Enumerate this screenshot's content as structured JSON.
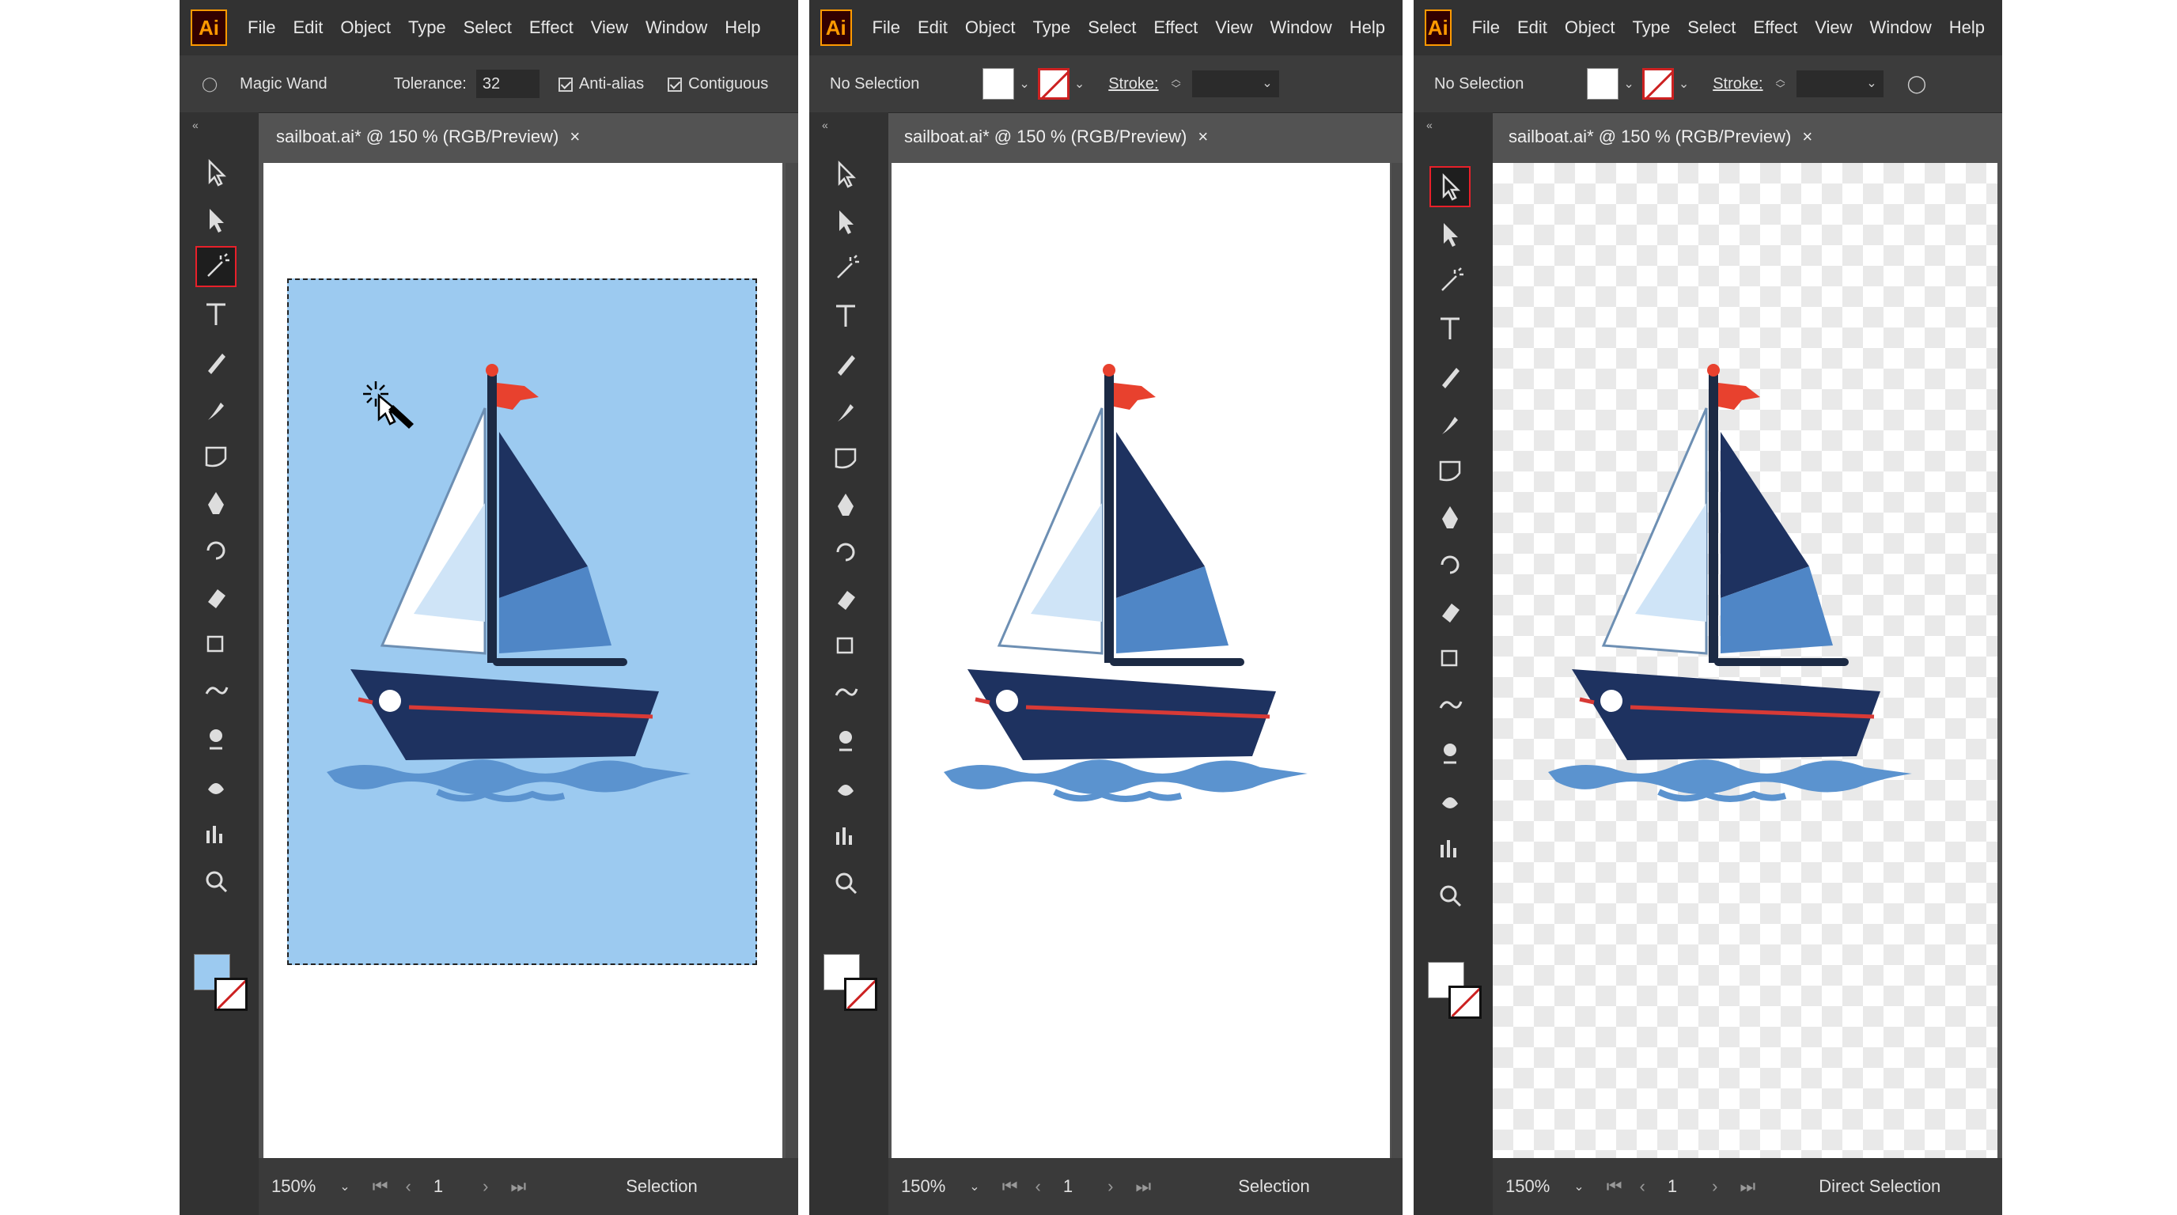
{
  "menu": [
    "File",
    "Edit",
    "Object",
    "Type",
    "Select",
    "Effect",
    "View",
    "Window",
    "Help"
  ],
  "app_logo": "Ai",
  "panels": [
    {
      "control": {
        "tool_name": "Magic Wand",
        "tolerance_label": "Tolerance:",
        "tolerance_value": "32",
        "antialias_label": "Anti-alias",
        "contiguous_label": "Contiguous"
      },
      "tab_title": "sailboat.ai* @ 150 % (RGB/Preview)",
      "status": {
        "zoom": "150%",
        "page": "1",
        "tool": "Selection"
      },
      "active_tool": "magic-wand",
      "fill_color": "#9ccaf0",
      "background": "#9ccaf0"
    },
    {
      "control": {
        "selection": "No Selection",
        "stroke_label": "Stroke:"
      },
      "tab_title": "sailboat.ai* @ 150 % (RGB/Preview)",
      "status": {
        "zoom": "150%",
        "page": "1",
        "tool": "Selection"
      },
      "active_tool": "none",
      "fill_color": "#ffffff",
      "background": "#ffffff"
    },
    {
      "control": {
        "selection": "No Selection",
        "stroke_label": "Stroke:"
      },
      "tab_title": "sailboat.ai* @ 150 % (RGB/Preview)",
      "status": {
        "zoom": "150%",
        "page": "1",
        "tool": "Direct Selection"
      },
      "active_tool": "selection",
      "fill_color": "#ffffff",
      "background": "transparent"
    }
  ],
  "colors": {
    "hull": "#1e3260",
    "dark_sail": "#1e3260",
    "mid_sail": "#4f86c6",
    "light_sail": "#ffffff",
    "pale_sail": "#cfe4f7",
    "flag": "#e8412e",
    "stripe": "#d83a36",
    "wave": "#5b93cf",
    "mast": "#1c2a44"
  },
  "tool_icons": [
    "selection-arrow-icon",
    "direct-selection-icon",
    "magic-wand-icon",
    "type-tool-icon",
    "pencil-icon",
    "brush-icon",
    "shape-icon",
    "pen-icon",
    "rotate-icon",
    "eraser-icon",
    "scale-icon",
    "warp-icon",
    "puppet-icon",
    "symbol-icon",
    "graph-icon",
    "zoom-icon"
  ]
}
